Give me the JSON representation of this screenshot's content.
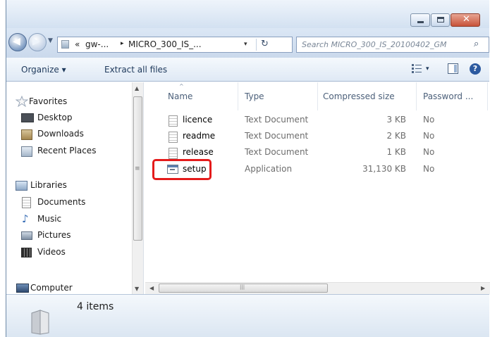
{
  "window": {
    "minimize_icon": "minimize-icon",
    "maximize_icon": "maximize-icon",
    "close_icon": "close-icon"
  },
  "address_bar": {
    "overflow_glyph": "«",
    "crumbs": [
      "gw-...",
      "MICRO_300_IS_..."
    ],
    "separator_glyph": "▸",
    "dropdown_glyph": "▾",
    "refresh_icon": "refresh-icon"
  },
  "search": {
    "placeholder": "Search MICRO_300_IS_20100402_GM",
    "icon": "search-icon"
  },
  "toolbar": {
    "organize_label": "Organize ▾",
    "extract_label": "Extract all files",
    "views_dropdown_glyph": "▾"
  },
  "nav_pane": {
    "favorites": {
      "label": "Favorites",
      "items": [
        "Desktop",
        "Downloads",
        "Recent Places"
      ]
    },
    "libraries": {
      "label": "Libraries",
      "items": [
        "Documents",
        "Music",
        "Pictures",
        "Videos"
      ]
    },
    "computer": {
      "label": "Computer"
    }
  },
  "file_list": {
    "columns": [
      "Name",
      "Type",
      "Compressed size",
      "Password ..."
    ],
    "rows": [
      {
        "name": "licence",
        "type": "Text Document",
        "size": "3 KB",
        "password": "No",
        "icon": "text-document-icon"
      },
      {
        "name": "readme",
        "type": "Text Document",
        "size": "2 KB",
        "password": "No",
        "icon": "text-document-icon"
      },
      {
        "name": "release",
        "type": "Text Document",
        "size": "1 KB",
        "password": "No",
        "icon": "text-document-icon"
      },
      {
        "name": "setup",
        "type": "Application",
        "size": "31,130 KB",
        "password": "No",
        "icon": "application-icon"
      }
    ],
    "highlighted_row": "setup",
    "highlight_color": "#e41b1b"
  },
  "status_bar": {
    "item_count": "4 items"
  },
  "colors": {
    "title_gradient_top": "#eef4fb",
    "toolbar_text": "#1e395b",
    "column_header_text": "#4c607a",
    "detail_text": "#6d6d6d"
  }
}
